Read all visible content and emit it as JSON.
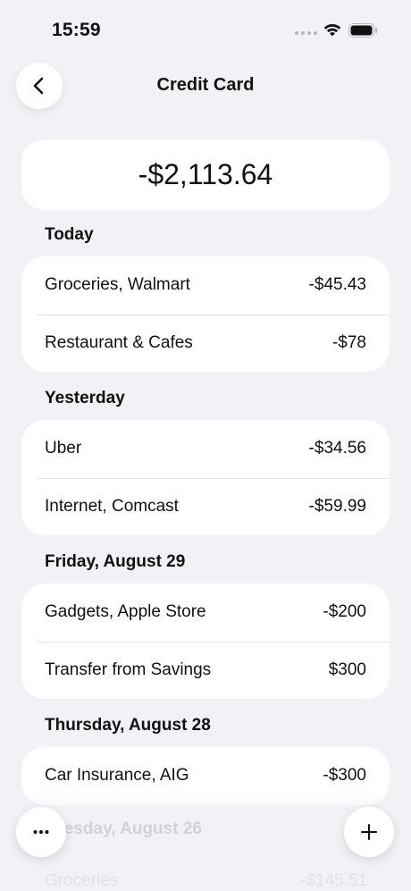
{
  "status_bar": {
    "time": "15:59"
  },
  "nav": {
    "title": "Credit Card"
  },
  "balance": "-$2,113.64",
  "sections": [
    {
      "header": "Today",
      "rows": [
        {
          "label": "Groceries, Walmart",
          "amount": "-$45.43"
        },
        {
          "label": "Restaurant & Cafes",
          "amount": "-$78"
        }
      ]
    },
    {
      "header": "Yesterday",
      "rows": [
        {
          "label": "Uber",
          "amount": "-$34.56"
        },
        {
          "label": "Internet, Comcast",
          "amount": "-$59.99"
        }
      ]
    },
    {
      "header": "Friday, August 29",
      "rows": [
        {
          "label": "Gadgets, Apple Store",
          "amount": "-$200"
        },
        {
          "label": "Transfer from Savings",
          "amount": "$300"
        }
      ]
    },
    {
      "header": "Thursday, August 28",
      "rows": [
        {
          "label": "Car Insurance, AIG",
          "amount": "-$300"
        }
      ]
    },
    {
      "header": "Tuesday, August 26",
      "rows": [
        {
          "label": "Groceries",
          "amount": "-$145.51"
        }
      ]
    }
  ],
  "icons": {
    "back": "chevron-left-icon",
    "more": "ellipsis-icon",
    "add": "plus-icon",
    "wifi": "wifi-icon",
    "battery": "battery-icon"
  }
}
